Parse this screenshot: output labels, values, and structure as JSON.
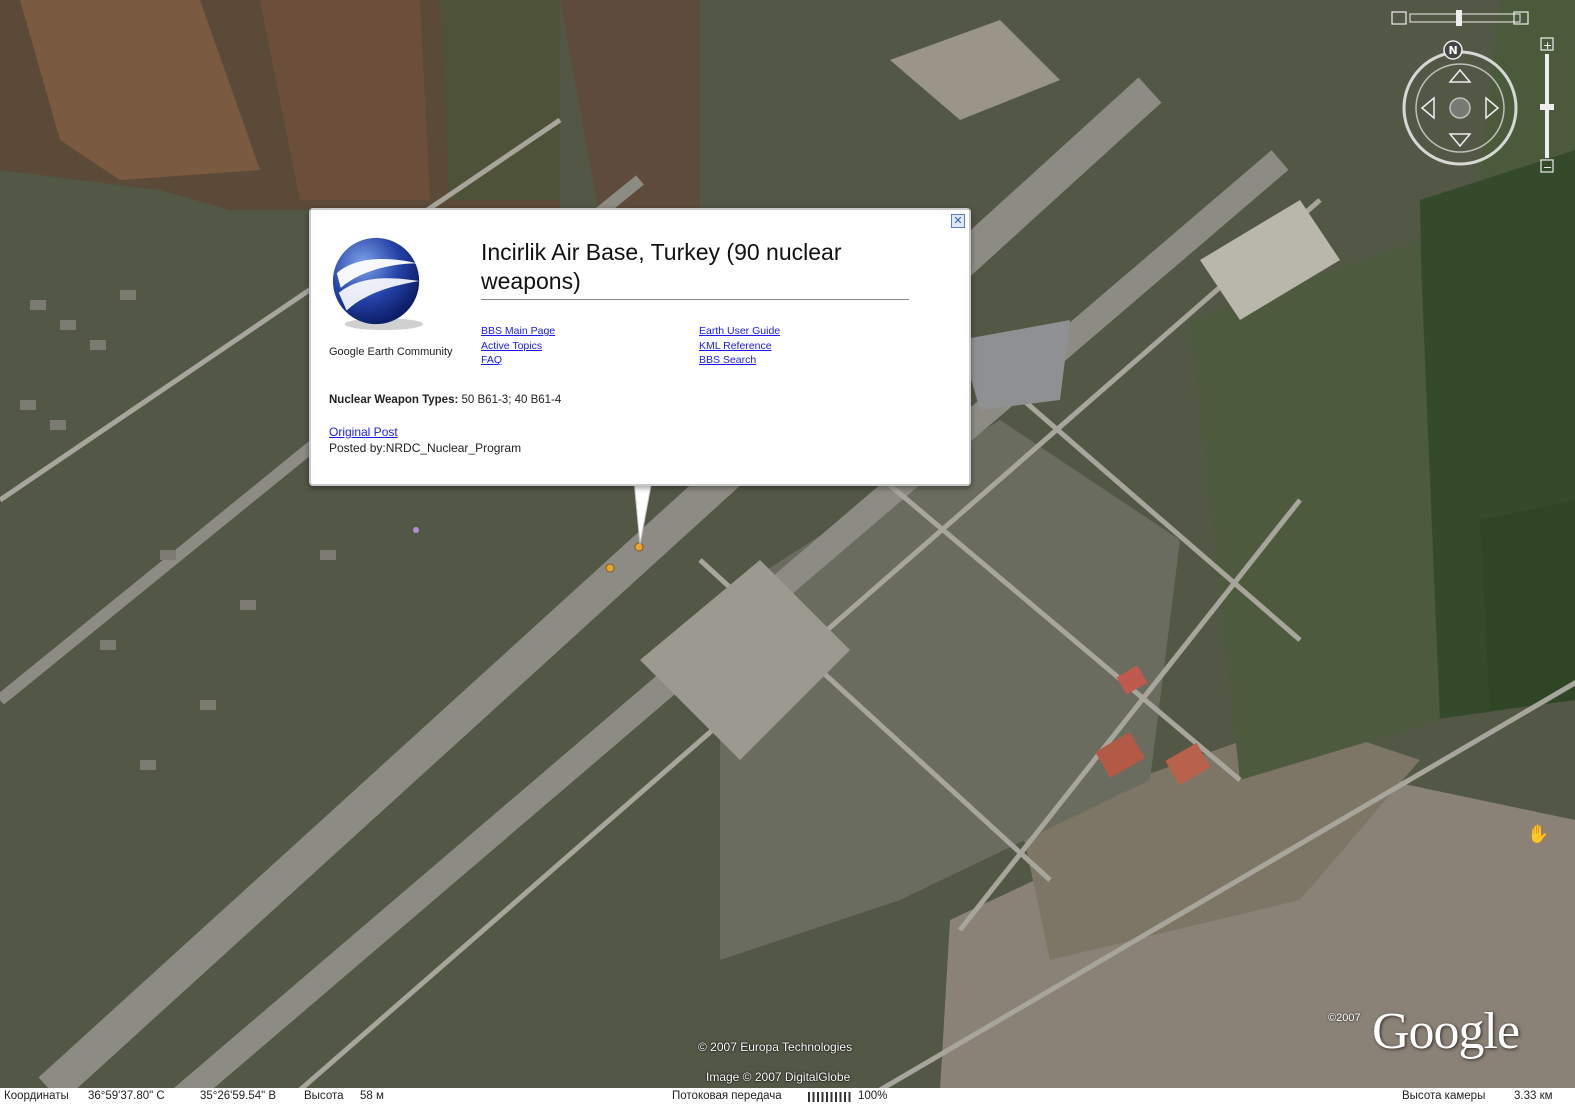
{
  "placemark": {
    "title": "Incirlik Air Base, Turkey (90 nuclear weapons)",
    "community_label": "Google Earth Community",
    "links_left": [
      "BBS Main Page",
      "Active Topics",
      "FAQ"
    ],
    "links_right": [
      "Earth User Guide",
      "KML Reference",
      "BBS Search"
    ],
    "nuclear_label": "Nuclear Weapon Types:",
    "nuclear_value": "50 B61-3; 40 B61-4",
    "original_post": "Original Post",
    "posted_by": "Posted by:NRDC_Nuclear_Program",
    "close_glyph": "✕"
  },
  "credits": {
    "europa": "© 2007 Europa Technologies",
    "digitalglobe": "Image © 2007 DigitalGlobe",
    "year": "©2007",
    "logo": "Google"
  },
  "statusbar": {
    "coords_label": "Координаты",
    "lat": "36°59'37.80\" С",
    "lon": "35°26'59.54\" В",
    "elev_label": "Высота",
    "elev_value": "58 м",
    "stream_label": "Потоковая передача",
    "stream_pct": "100%",
    "stream_progress": 1.0,
    "camera_label": "Высота камеры",
    "camera_value": "3.33 км"
  },
  "nav": {
    "north": "N",
    "zoom_in": "+",
    "zoom_out": "−"
  },
  "colors": {
    "link": "#1a1aee",
    "balloon_border": "#c9c9c9",
    "marker": "#e8a533"
  },
  "icons": [
    "google-earth-globe-icon",
    "close-icon",
    "compass-icon",
    "look-joystick-icon",
    "zoom-in-icon",
    "zoom-out-icon",
    "hand-cursor-icon",
    "placemark-icon"
  ]
}
